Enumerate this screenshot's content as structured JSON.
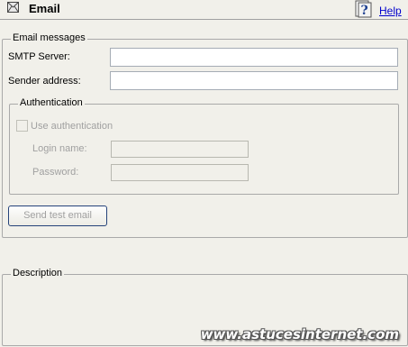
{
  "header": {
    "title": "Email",
    "help_label": "Help"
  },
  "email_group": {
    "legend": "Email messages",
    "smtp_label": "SMTP Server:",
    "smtp_value": "",
    "sender_label": "Sender address:",
    "sender_value": ""
  },
  "auth_group": {
    "legend": "Authentication",
    "use_auth_label": "Use authentication",
    "use_auth_checked": false,
    "login_label": "Login name:",
    "login_value": "",
    "password_label": "Password:",
    "password_value": ""
  },
  "send_test_button": "Send test email",
  "description_group": {
    "legend": "Description"
  },
  "watermark": "www.astucesinternet.com",
  "icons": {
    "title_icon": "envelope-icon",
    "help_icon": "help-question-icon"
  }
}
